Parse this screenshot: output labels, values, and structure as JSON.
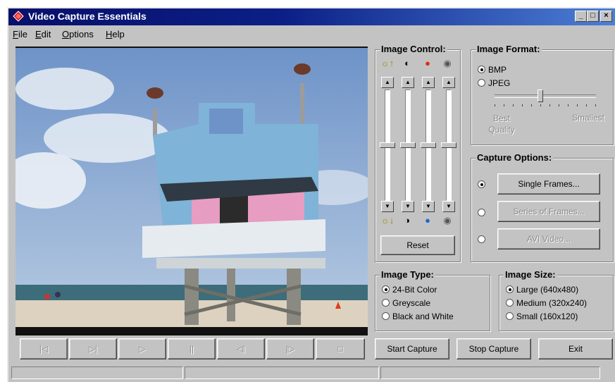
{
  "window": {
    "title": "Video Capture Essentials",
    "controls": {
      "minimize": "_",
      "maximize": "□",
      "close": "×"
    }
  },
  "menu": {
    "items": [
      {
        "label": "File",
        "underline": "F",
        "rest": "ile"
      },
      {
        "label": "Edit",
        "underline": "E",
        "rest": "dit"
      },
      {
        "label": "Options",
        "underline": "O",
        "rest": "ptions"
      },
      {
        "label": "Help",
        "underline": "H",
        "rest": "elp"
      }
    ]
  },
  "image_control": {
    "title": "Image Control:",
    "icons": [
      "brightness-up-icon",
      "contrast-up-icon",
      "color-up-icon",
      "saturation-up-icon"
    ],
    "icons_bottom": [
      "brightness-down-icon",
      "contrast-down-icon",
      "color-down-icon",
      "saturation-down-icon"
    ],
    "levels": [
      0.5,
      0.5,
      0.5,
      0.5
    ],
    "reset_label": "Reset"
  },
  "image_format": {
    "title": "Image Format:",
    "options": [
      "BMP",
      "JPEG"
    ],
    "selected": "BMP",
    "quality_left": "Best Quality",
    "quality_right": "Smallest",
    "quality_level": 0.45
  },
  "capture_options": {
    "title": "Capture Options:",
    "buttons": [
      {
        "label": "Single Frames...",
        "enabled": true,
        "selected": true
      },
      {
        "label": "Series of Frames...",
        "enabled": false,
        "selected": false
      },
      {
        "label": "AVI Video...",
        "enabled": false,
        "selected": false
      }
    ]
  },
  "image_type": {
    "title": "Image Type:",
    "options": [
      "24-Bit Color",
      "Greyscale",
      "Black and White"
    ],
    "selected": "24-Bit Color"
  },
  "image_size": {
    "title": "Image Size:",
    "options": [
      "Large (640x480)",
      "Medium (320x240)",
      "Small (160x120)"
    ],
    "selected": "Large (640x480)"
  },
  "transport": {
    "buttons": [
      "first-frame-icon",
      "next-icon",
      "play-icon",
      "pause-icon",
      "step-back-icon",
      "step-forward-icon",
      "stop-icon"
    ]
  },
  "actions": {
    "start": "Start Capture",
    "stop": "Stop Capture",
    "exit": "Exit"
  }
}
